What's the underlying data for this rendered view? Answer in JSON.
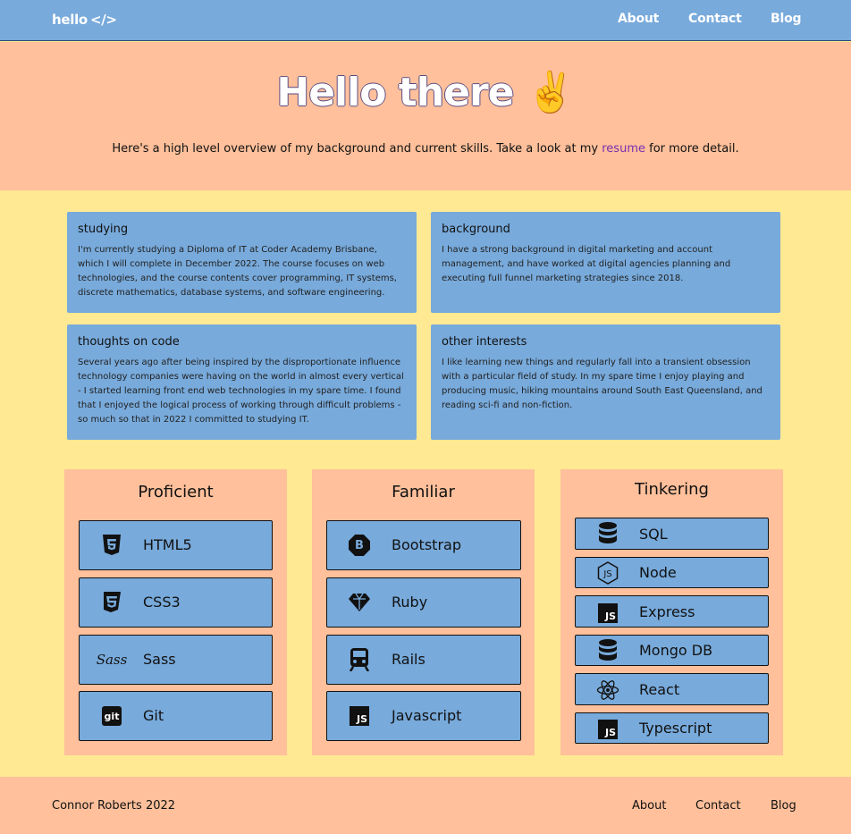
{
  "nav": {
    "brand": "hello",
    "brand_code": "</>",
    "links": [
      "About",
      "Contact",
      "Blog"
    ]
  },
  "hero": {
    "title": "Hello there",
    "emoji": "✌️",
    "subtitle_pre": "Here's a high level overview of my background and current skills. Take a look at my ",
    "resume_link": "resume",
    "subtitle_post": " for more detail."
  },
  "cards": [
    {
      "title": "studying",
      "body": "I'm currently studying a Diploma of IT at Coder Academy Brisbane, which I will complete in December 2022. The course focuses on web technologies, and the course contents cover programming, IT systems, discrete mathematics, database systems, and software engineering."
    },
    {
      "title": "background",
      "body": "I have a strong background in digital marketing and account management, and have worked at digital agencies planning and executing full funnel marketing strategies since 2018."
    },
    {
      "title": "thoughts on code",
      "body": "Several years ago after being inspired by the disproportionate influence technology companies were having on the world in almost every vertical - I started learning front end web technologies in my spare time. I found that I enjoyed the logical process of working through difficult problems - so much so that in 2022 I committed to studying IT."
    },
    {
      "title": "other interests",
      "body": "I like learning new things and regularly fall into a transient obsession with a particular field of study. In my spare time I enjoy playing and producing music, hiking mountains around South East Queensland, and reading sci-fi and non-fiction."
    }
  ],
  "skills": {
    "proficient": {
      "title": "Proficient",
      "items": [
        {
          "label": "HTML5",
          "icon": "html5-icon"
        },
        {
          "label": "CSS3",
          "icon": "css3-icon"
        },
        {
          "label": "Sass",
          "icon": "sass-icon"
        },
        {
          "label": "Git",
          "icon": "git-icon"
        }
      ]
    },
    "familiar": {
      "title": "Familiar",
      "items": [
        {
          "label": "Bootstrap",
          "icon": "bootstrap-icon"
        },
        {
          "label": "Ruby",
          "icon": "ruby-icon"
        },
        {
          "label": "Rails",
          "icon": "rails-icon"
        },
        {
          "label": "Javascript",
          "icon": "javascript-icon"
        }
      ]
    },
    "tinkering": {
      "title": "Tinkering",
      "items": [
        {
          "label": "SQL",
          "icon": "database-icon"
        },
        {
          "label": "Node",
          "icon": "nodejs-icon"
        },
        {
          "label": "Express",
          "icon": "javascript-icon"
        },
        {
          "label": "Mongo DB",
          "icon": "database-icon"
        },
        {
          "label": "React",
          "icon": "react-icon"
        },
        {
          "label": "Typescript",
          "icon": "javascript-icon"
        }
      ]
    }
  },
  "icon_text": {
    "bootstrap": "B",
    "js": "JS",
    "git": "git",
    "nodejs": "JS",
    "sass": "Sass"
  },
  "footer": {
    "copyright": "Connor Roberts 2022",
    "links": [
      "About",
      "Contact",
      "Blog"
    ]
  },
  "colors": {
    "nav": "#78aadb",
    "peach": "#ffc09b",
    "yellow": "#ffe993",
    "link": "#7a2fb0"
  }
}
